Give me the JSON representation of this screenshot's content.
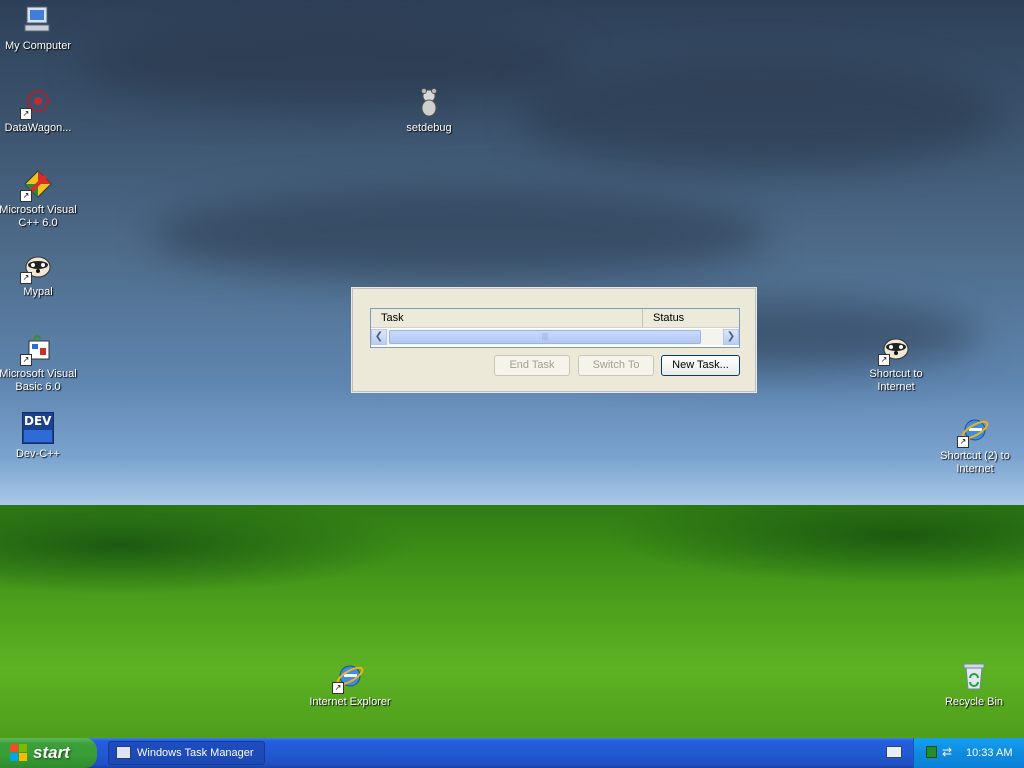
{
  "desktop_icons": {
    "my_computer": {
      "label": "My Computer"
    },
    "datawagon": {
      "label": "DataWagon..."
    },
    "setdebug": {
      "label": "setdebug"
    },
    "msvc": {
      "label": "Microsoft Visual C++ 6.0"
    },
    "mypal": {
      "label": "Mypal"
    },
    "msvb": {
      "label": "Microsoft Visual Basic 6.0"
    },
    "devcpp": {
      "label": "Dev-C++",
      "badge": "DEV"
    },
    "shortcut_internet": {
      "label": "Shortcut to Internet"
    },
    "shortcut2_internet": {
      "label": "Shortcut (2) to Internet"
    },
    "internet_explorer": {
      "label": "Internet Explorer"
    },
    "recycle_bin": {
      "label": "Recycle Bin"
    }
  },
  "task_manager": {
    "columns": {
      "task": "Task",
      "status": "Status"
    },
    "buttons": {
      "end_task": "End Task",
      "switch_to": "Switch To",
      "new_task": "New Task..."
    }
  },
  "taskbar": {
    "start_label": "start",
    "task_button_label": "Windows Task Manager",
    "clock": "10:33 AM"
  },
  "colors": {
    "taskbar_blue": "#245edb",
    "start_green": "#3c9f3a",
    "tray_blue": "#0f8be0"
  }
}
